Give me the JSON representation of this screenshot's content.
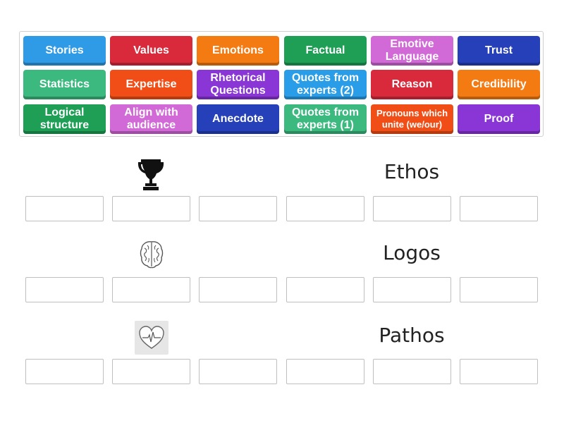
{
  "tiles": [
    {
      "label": "Stories",
      "color": "#2f9be6"
    },
    {
      "label": "Values",
      "color": "#d92a3c"
    },
    {
      "label": "Emotions",
      "color": "#f47a12"
    },
    {
      "label": "Factual",
      "color": "#1f9e56"
    },
    {
      "label": "Emotive Language",
      "color": "#d169d6"
    },
    {
      "label": "Trust",
      "color": "#2540b8"
    },
    {
      "label": "Statistics",
      "color": "#3cb97f"
    },
    {
      "label": "Expertise",
      "color": "#f04e16"
    },
    {
      "label": "Rhetorical Questions",
      "color": "#8a35d6"
    },
    {
      "label": "Quotes from experts (2)",
      "color": "#2a9de8"
    },
    {
      "label": "Reason",
      "color": "#d92a3c"
    },
    {
      "label": "Credibility",
      "color": "#f47a12"
    },
    {
      "label": "Logical structure",
      "color": "#1f9e56"
    },
    {
      "label": "Align with audience",
      "color": "#d169d6"
    },
    {
      "label": "Anecdote",
      "color": "#2540b8"
    },
    {
      "label": "Quotes from experts (1)",
      "color": "#3cb97f"
    },
    {
      "label": "Pronouns which unite (we/our)",
      "color": "#f04e16"
    },
    {
      "label": "Proof",
      "color": "#8a35d6"
    }
  ],
  "categories": [
    {
      "title": "Ethos",
      "icon": "trophy-icon",
      "slot_count": 6
    },
    {
      "title": "Logos",
      "icon": "brain-icon",
      "slot_count": 6
    },
    {
      "title": "Pathos",
      "icon": "heart-pulse-icon",
      "slot_count": 6
    }
  ]
}
